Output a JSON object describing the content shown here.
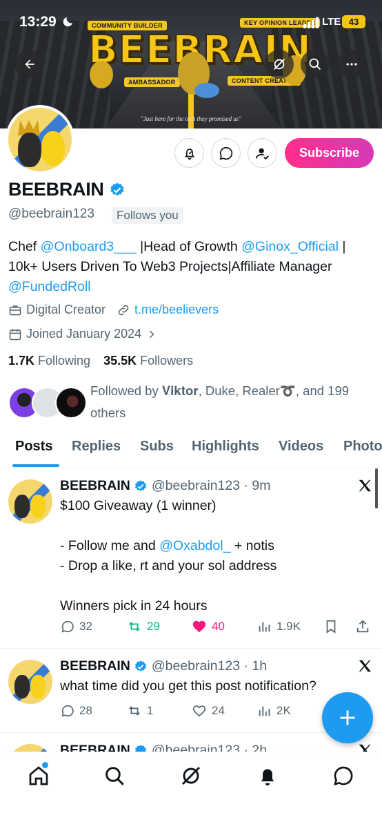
{
  "status_bar": {
    "time": "13:29",
    "network": "LTE",
    "battery": "43"
  },
  "banner": {
    "title": "BEEBRAIN",
    "tag_community": "COMMUNITY BUILDER",
    "tag_kol": "KEY OPINION LEADER",
    "tag_ambassador": "AMBASSADOR",
    "tag_content": "CONTENT CREATOR",
    "quote": "\"Just here for the tech they promised us\""
  },
  "profile": {
    "name": "BEEBRAIN",
    "handle": "@beebrain123",
    "follows_you": "Follows you",
    "subscribe_label": "Subscribe",
    "bio": {
      "t1": "Chef ",
      "m1": "@Onboard3___",
      "t2": " |Head of Growth ",
      "m2": "@Ginox_Official",
      "t3": " | 10k+ Users Driven To Web3 Projects|Affiliate Manager ",
      "m3": "@FundedRoll"
    },
    "category": "Digital Creator",
    "website": "t.me/beelievers",
    "joined": "Joined January 2024",
    "following_count": "1.7K",
    "following_label": " Following",
    "followers_count": "35.5K",
    "followers_label": " Followers",
    "followed_by": "Followed by ",
    "followed_by_names": "𝐕𝐢𝐤𝐭𝐨𝐫, Duke, Realer➰",
    "followed_by_rest": ", and 199 others"
  },
  "tabs": [
    "Posts",
    "Replies",
    "Subs",
    "Highlights",
    "Videos",
    "Photos"
  ],
  "posts": [
    {
      "name": "BEEBRAIN",
      "handle_time": "@beebrain123 · 9m",
      "text_a": "$100 Giveaway (1 winner)\n\n- Follow me and ",
      "mention": "@Oxabdol_",
      "text_b": " + notis\n- Drop a like, rt and your sol address\n\nWinners pick in 24 hours",
      "replies": "32",
      "reposts": "29",
      "likes": "40",
      "views": "1.9K"
    },
    {
      "name": "BEEBRAIN",
      "handle_time": "@beebrain123 · 1h",
      "text": "what time did you get this post notification?",
      "replies": "28",
      "reposts": "1",
      "likes": "24",
      "views": "2K"
    },
    {
      "name": "BEEBRAIN",
      "handle_time": "@beebrain123 · 2h"
    }
  ],
  "colors": {
    "accent": "#1d9bf0",
    "repost_active": "#00ba7c",
    "like_active": "#f91880",
    "subscribe_start": "#ff2e8a",
    "subscribe_end": "#d63ab8"
  },
  "icons": [
    "back-arrow-icon",
    "grok-icon",
    "search-icon",
    "more-icon",
    "notification-bell-icon",
    "message-icon",
    "follow-user-icon",
    "verified-badge-icon",
    "briefcase-icon",
    "link-icon",
    "calendar-icon",
    "chevron-right-icon",
    "reply-icon",
    "repost-icon",
    "like-icon",
    "views-icon",
    "bookmark-icon",
    "share-icon",
    "x-logo-icon",
    "compose-plus-icon",
    "home-icon",
    "explore-icon",
    "notifications-icon",
    "messages-icon"
  ]
}
